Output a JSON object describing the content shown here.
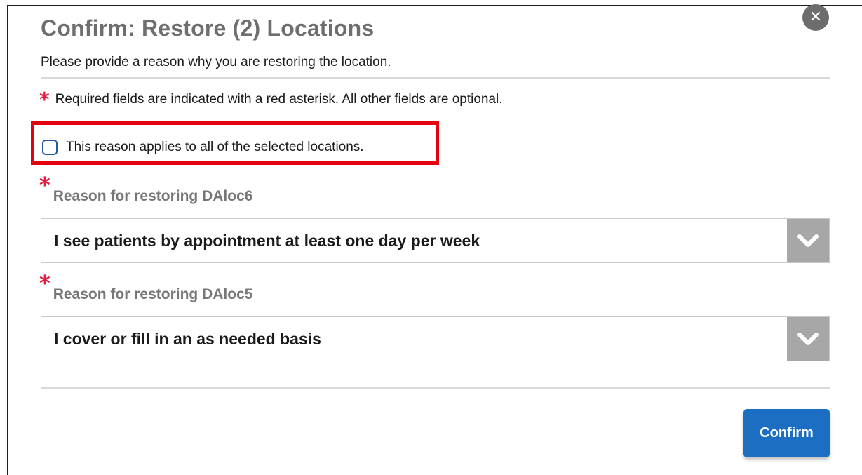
{
  "dialog": {
    "title": "Confirm: Restore (2) Locations",
    "intro": "Please provide a reason why you are restoring the location.",
    "close_icon": "close-icon",
    "required_marker": "*",
    "required_note": "Required fields are indicated with a red asterisk. All other fields are optional.",
    "apply_all": {
      "label": "This reason applies to all of the selected locations.",
      "checked": false
    },
    "fields": [
      {
        "label": "Reason for restoring DAloc6",
        "value": "I see patients by appointment at least one day per week"
      },
      {
        "label": "Reason for restoring DAloc5",
        "value": "I cover or fill in an as needed basis"
      }
    ],
    "confirm_label": "Confirm"
  },
  "colors": {
    "accent": "#1b6ec2",
    "required": "#e31c3d",
    "highlight": "#e4000f"
  }
}
